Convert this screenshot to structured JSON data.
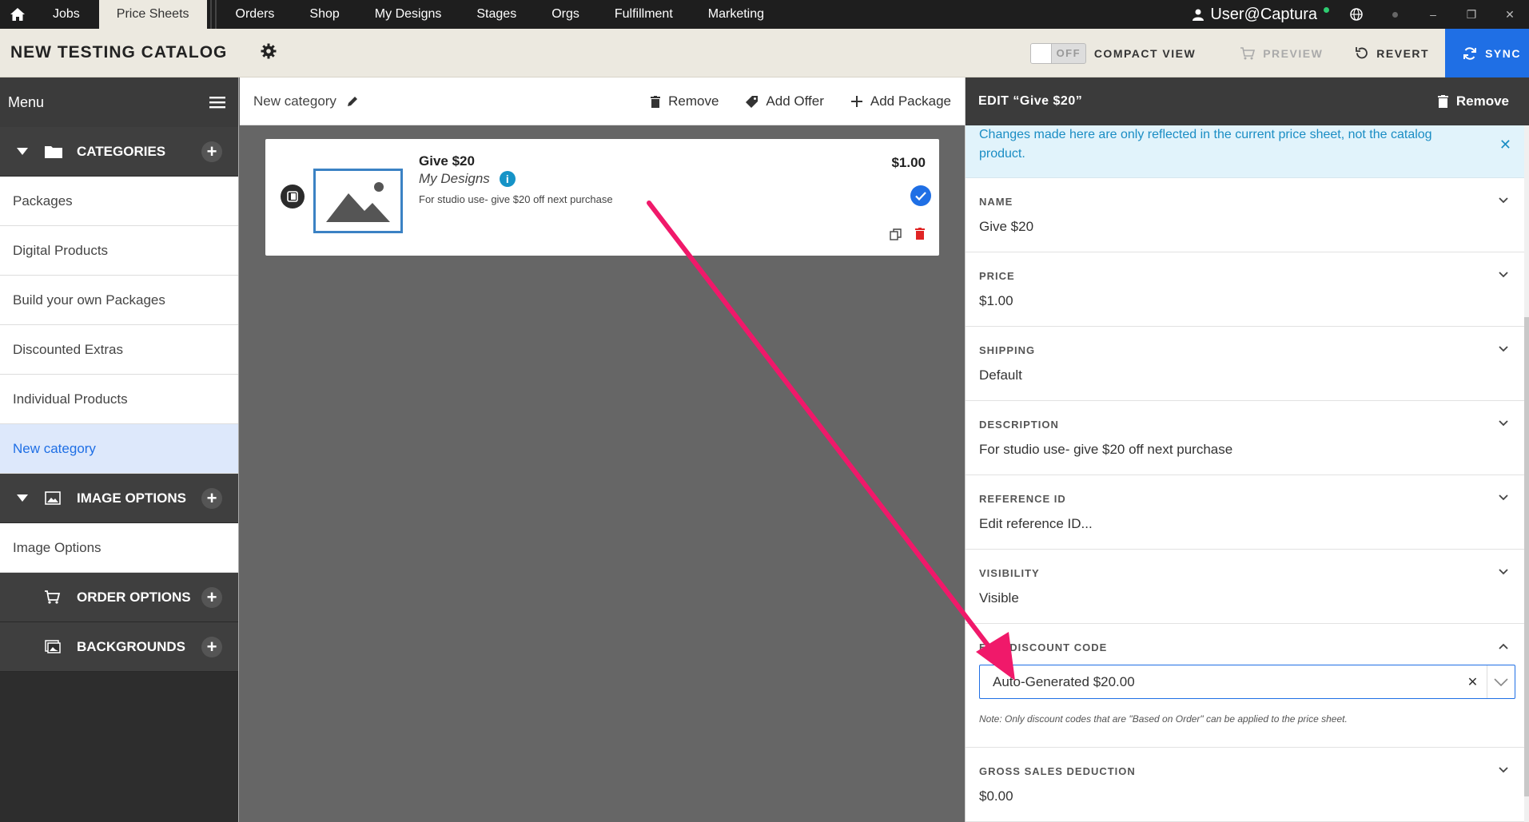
{
  "topnav": {
    "tabs": [
      "Jobs",
      "Price Sheets",
      "Orders",
      "Shop",
      "My Designs",
      "Stages",
      "Orgs",
      "Fulfillment",
      "Marketing"
    ],
    "active_tab": "Price Sheets",
    "user": "User@Captura"
  },
  "catalog": {
    "title": "NEW TESTING CATALOG",
    "toggle_label": "OFF",
    "compact_view": "COMPACT VIEW",
    "preview": "PREVIEW",
    "revert": "REVERT",
    "sync": "SYNC"
  },
  "sidebar": {
    "menu_label": "Menu",
    "categories_label": "CATEGORIES",
    "category_items": [
      "Packages",
      "Digital Products",
      "Build your own Packages",
      "Discounted Extras",
      "Individual Products",
      "New category"
    ],
    "active_category": "New category",
    "image_options_label": "IMAGE OPTIONS",
    "image_option_items": [
      "Image Options"
    ],
    "order_options_label": "ORDER OPTIONS",
    "backgrounds_label": "BACKGROUNDS"
  },
  "center": {
    "category_name": "New category",
    "remove": "Remove",
    "add_offer": "Add Offer",
    "add_package": "Add Package"
  },
  "product": {
    "name": "Give $20",
    "source": "My Designs",
    "description": "For studio use- give $20 off next purchase",
    "price": "$1.00"
  },
  "panel": {
    "title": "EDIT “Give $20”",
    "remove": "Remove",
    "notice": "Changes made here are only reflected in the current price sheet, not the catalog product.",
    "fields": [
      {
        "label": "NAME",
        "value": "Give $20"
      },
      {
        "label": "PRICE",
        "value": "$1.00"
      },
      {
        "label": "SHIPPING",
        "value": "Default"
      },
      {
        "label": "DESCRIPTION",
        "value": "For studio use- give $20 off next purchase"
      },
      {
        "label": "REFERENCE ID",
        "value": "Edit reference ID..."
      },
      {
        "label": "VISIBILITY",
        "value": "Visible"
      }
    ],
    "discount": {
      "label": "EDIT DISCOUNT CODE",
      "value": "Auto-Generated $20.00",
      "note": "Note: Only discount codes that are \"Based on Order\" can be applied to the price sheet."
    },
    "gross": {
      "label": "GROSS SALES DEDUCTION",
      "value": "$0.00"
    }
  },
  "colors": {
    "accent": "#1f6fe5",
    "arrow": "#f0196a",
    "notice_bg": "#e1f3fb"
  }
}
